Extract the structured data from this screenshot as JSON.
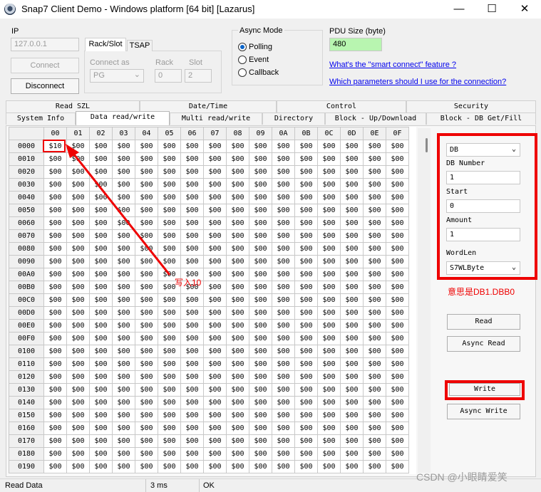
{
  "window": {
    "title": "Snap7 Client Demo - Windows platform [64 bit] [Lazarus]",
    "minimize_glyph": "—",
    "maximize_glyph": "☐",
    "close_glyph": "✕"
  },
  "connection": {
    "ip_label": "IP",
    "ip_value": "127.0.0.1",
    "connect_label": "Connect",
    "disconnect_label": "Disconnect",
    "tab_rackslot": "Rack/Slot",
    "tab_tsap": "TSAP",
    "connect_as_label": "Connect as",
    "connect_as_value": "PG",
    "rack_label": "Rack",
    "rack_value": "0",
    "slot_label": "Slot",
    "slot_value": "2"
  },
  "async_mode": {
    "label": "Async Mode",
    "options": [
      "Polling",
      "Event",
      "Callback"
    ],
    "selected": "Polling"
  },
  "pdu": {
    "label": "PDU Size (byte)",
    "value": "480"
  },
  "links": {
    "smart_connect": "What's the \"smart connect\" feature ?",
    "which_params": "Which parameters should I use for the connection?"
  },
  "tabs": {
    "row1": [
      "Read SZL",
      "Date/Time",
      "Control",
      "Security"
    ],
    "row2": [
      "System Info",
      "Data read/write",
      "Multi read/write",
      "Directory",
      "Block - Up/Download",
      "Block - DB Get/Fill"
    ],
    "active": "Data read/write"
  },
  "grid": {
    "col_headers": [
      "00",
      "01",
      "02",
      "03",
      "04",
      "05",
      "06",
      "07",
      "08",
      "09",
      "0A",
      "0B",
      "0C",
      "0D",
      "0E",
      "0F"
    ],
    "row_headers": [
      "0000",
      "0010",
      "0020",
      "0030",
      "0040",
      "0050",
      "0060",
      "0070",
      "0080",
      "0090",
      "00A0",
      "00B0",
      "00C0",
      "00D0",
      "00E0",
      "00F0",
      "0100",
      "0110",
      "0120",
      "0130",
      "0140",
      "0150",
      "0160",
      "0170",
      "0180",
      "0190"
    ],
    "default_cell": "$00",
    "first_cell": "$10"
  },
  "params": {
    "area_value": "DB",
    "db_number_label": "DB Number",
    "db_number_value": "1",
    "start_label": "Start",
    "start_value": "0",
    "amount_label": "Amount",
    "amount_value": "1",
    "wordlen_label": "WordLen",
    "wordlen_value": "S7WLByte"
  },
  "annotations": {
    "write_note": "写入10",
    "meaning_note": "意思是DB1.DBB0",
    "color": "#ee0000"
  },
  "actions": {
    "read": "Read",
    "async_read": "Async Read",
    "write": "Write",
    "async_write": "Async Write"
  },
  "status": {
    "op": "Read Data",
    "time": "3 ms",
    "result": "OK"
  },
  "watermark": "CSDN @小眼睛爱笑"
}
